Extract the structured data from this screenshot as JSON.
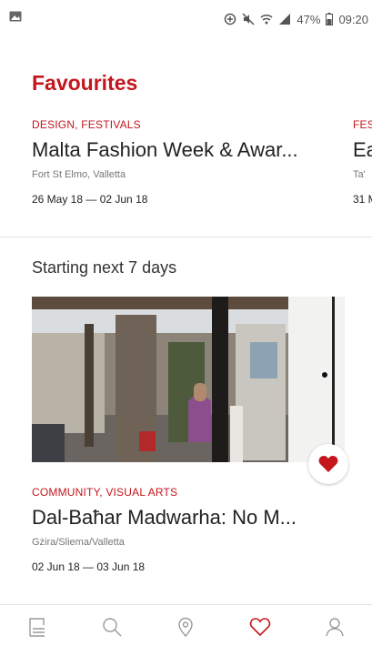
{
  "status_bar": {
    "battery": "47%",
    "time": "09:20"
  },
  "page": {
    "title": "Favourites"
  },
  "favourites": [
    {
      "categories": "DESIGN, FESTIVALS",
      "title": "Malta Fashion Week & Awar...",
      "location": "Fort St Elmo, Valletta",
      "dates": "26 May 18 — 02 Jun 18"
    },
    {
      "categories": "FES",
      "title": "Ea",
      "location": "Ta'",
      "dates": "31 M"
    }
  ],
  "upcoming": {
    "section_title": "Starting next 7 days",
    "event": {
      "categories": "COMMUNITY, VISUAL ARTS",
      "title": "Dal-Baħar Madwarha: No M...",
      "location": "Gżira/Sliema/Valletta",
      "dates": "02 Jun 18 — 03 Jun 18"
    }
  },
  "nav": {
    "items": [
      {
        "icon": "list-icon"
      },
      {
        "icon": "search-icon"
      },
      {
        "icon": "map-pin-icon"
      },
      {
        "icon": "heart-icon",
        "active": true
      },
      {
        "icon": "profile-icon"
      }
    ],
    "active_color": "#c4161c",
    "inactive_color": "#9a9a9a"
  },
  "colors": {
    "accent": "#c4161c"
  }
}
